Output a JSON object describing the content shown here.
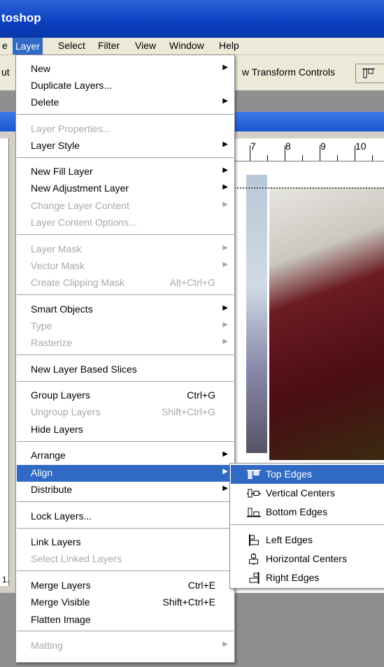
{
  "window": {
    "title": "toshop"
  },
  "menubar": {
    "items": [
      {
        "label": "e"
      },
      {
        "label": "Layer"
      },
      {
        "label": "Select"
      },
      {
        "label": "Filter"
      },
      {
        "label": "View"
      },
      {
        "label": "Window"
      },
      {
        "label": "Help"
      }
    ]
  },
  "options_bar": {
    "left_fragment": "ut",
    "transform_label": "w Transform Controls"
  },
  "ruler": {
    "numbers": [
      "7",
      "8",
      "9",
      "10"
    ]
  },
  "layer_menu": {
    "items": [
      {
        "label": "New",
        "arrow": true
      },
      {
        "label": "Duplicate Layers..."
      },
      {
        "label": "Delete",
        "arrow": true
      },
      {
        "label": "Layer Properties...",
        "disabled": true
      },
      {
        "label": "Layer Style",
        "arrow": true
      },
      {
        "label": "New Fill Layer",
        "arrow": true
      },
      {
        "label": "New Adjustment Layer",
        "arrow": true
      },
      {
        "label": "Change Layer Content",
        "arrow": true,
        "disabled": true
      },
      {
        "label": "Layer Content Options...",
        "disabled": true
      },
      {
        "label": "Layer Mask",
        "arrow": true,
        "disabled": true
      },
      {
        "label": "Vector Mask",
        "arrow": true,
        "disabled": true
      },
      {
        "label": "Create Clipping Mask",
        "shortcut": "Alt+Ctrl+G",
        "disabled": true
      },
      {
        "label": "Smart Objects",
        "arrow": true
      },
      {
        "label": "Type",
        "arrow": true,
        "disabled": true
      },
      {
        "label": "Rasterize",
        "arrow": true,
        "disabled": true
      },
      {
        "label": "New Layer Based Slices"
      },
      {
        "label": "Group Layers",
        "shortcut": "Ctrl+G"
      },
      {
        "label": "Ungroup Layers",
        "shortcut": "Shift+Ctrl+G",
        "disabled": true
      },
      {
        "label": "Hide Layers"
      },
      {
        "label": "Arrange",
        "arrow": true
      },
      {
        "label": "Align",
        "arrow": true,
        "highlighted": true
      },
      {
        "label": "Distribute",
        "arrow": true
      },
      {
        "label": "Lock Layers..."
      },
      {
        "label": "Link Layers"
      },
      {
        "label": "Select Linked Layers",
        "disabled": true
      },
      {
        "label": "Merge Layers",
        "shortcut": "Ctrl+E"
      },
      {
        "label": "Merge Visible",
        "shortcut": "Shift+Ctrl+E"
      },
      {
        "label": "Flatten Image"
      },
      {
        "label": "Matting",
        "arrow": true,
        "disabled": true
      }
    ]
  },
  "align_submenu": {
    "items": [
      {
        "label": "Top Edges",
        "icon": "align-top-edges-icon",
        "highlighted": true
      },
      {
        "label": "Vertical Centers",
        "icon": "align-vertical-centers-icon"
      },
      {
        "label": "Bottom Edges",
        "icon": "align-bottom-edges-icon"
      },
      {
        "label": "Left Edges",
        "icon": "align-left-edges-icon"
      },
      {
        "label": "Horizontal Centers",
        "icon": "align-horizontal-centers-icon"
      },
      {
        "label": "Right Edges",
        "icon": "align-right-edges-icon"
      }
    ]
  },
  "left_ruler_fragment": "1."
}
